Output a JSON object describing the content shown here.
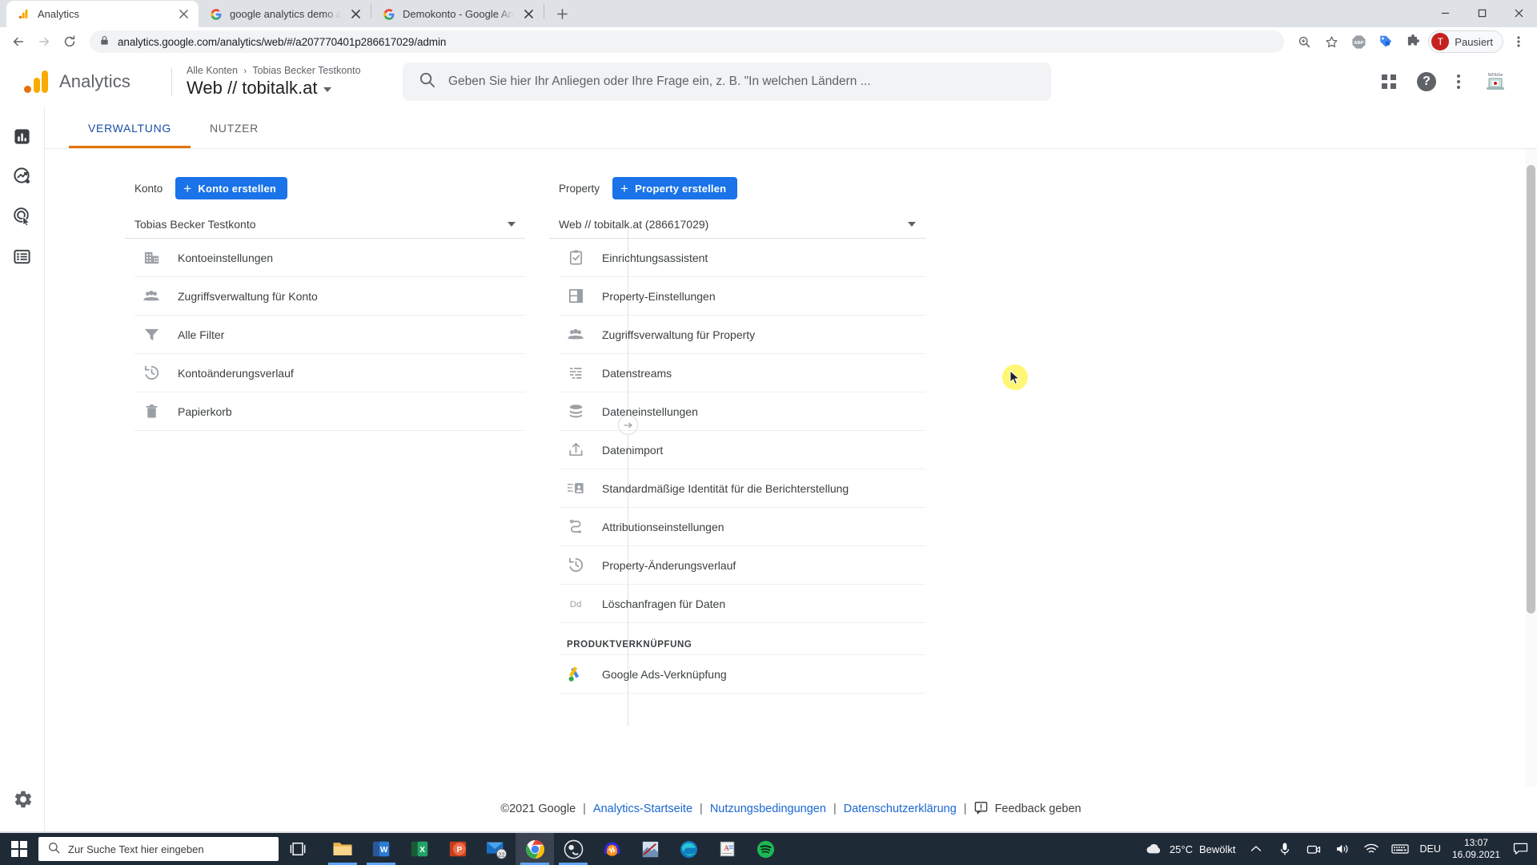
{
  "browser": {
    "tabs": [
      {
        "title": "Analytics",
        "favicon": "analytics-icon",
        "active": true
      },
      {
        "title": "google analytics demo account -",
        "favicon": "google-icon",
        "active": false
      },
      {
        "title": "Demokonto - Google Analytics-H",
        "favicon": "google-icon",
        "active": false
      }
    ],
    "new_tab_label": "+",
    "window_controls": {
      "minimize": "—",
      "maximize": "▢",
      "close": "✕"
    },
    "nav": {
      "back": "←",
      "forward": "→",
      "reload": "⟳"
    },
    "url": "analytics.google.com/analytics/web/#/a207770401p286617029/admin",
    "lock_icon": "lock-icon",
    "toolbar_icons": [
      "zoom-icon",
      "bookmark-star-icon",
      "adblock-icon",
      "tag-assistant-icon",
      "extensions-puzzle-icon"
    ],
    "profile": {
      "initial": "T",
      "label": "Pausiert"
    },
    "menu_icon": "chrome-menu-icon"
  },
  "analytics": {
    "brand": "Analytics",
    "breadcrumb": {
      "root": "Alle Konten",
      "separator": "›",
      "account": "Tobias Becker Testkonto"
    },
    "property_title": "Web // tobitalk.at",
    "search": {
      "placeholder": "Geben Sie hier Ihr Anliegen oder Ihre Frage ein, z. B. \"In welchen Ländern ..."
    },
    "header_icons": [
      "apps-grid-icon",
      "help-icon",
      "more-vert-icon",
      "avatar"
    ],
    "rail_items": [
      {
        "name": "reports-icon",
        "label": "Berichte"
      },
      {
        "name": "explore-icon",
        "label": "Explorativ"
      },
      {
        "name": "advertising-icon",
        "label": "Werbung"
      },
      {
        "name": "configure-icon",
        "label": "Konfigurieren"
      }
    ],
    "rail_bottom": {
      "name": "gear-icon",
      "label": "Verwaltung"
    },
    "tabs": [
      {
        "label": "VERWALTUNG",
        "selected": true
      },
      {
        "label": "NUTZER",
        "selected": false
      }
    ],
    "account_column": {
      "label": "Konto",
      "create_button": "Konto erstellen",
      "selected": "Tobias Becker Testkonto",
      "items": [
        {
          "icon": "building-icon",
          "label": "Kontoeinstellungen"
        },
        {
          "icon": "people-icon",
          "label": "Zugriffsverwaltung für Konto"
        },
        {
          "icon": "filter-icon",
          "label": "Alle Filter"
        },
        {
          "icon": "history-icon",
          "label": "Kontoänderungsverlauf"
        },
        {
          "icon": "trash-icon",
          "label": "Papierkorb"
        }
      ]
    },
    "property_column": {
      "label": "Property",
      "create_button": "Property erstellen",
      "selected": "Web // tobitalk.at (286617029)",
      "items": [
        {
          "icon": "checklist-icon",
          "label": "Einrichtungsassistent"
        },
        {
          "icon": "layout-icon",
          "label": "Property-Einstellungen"
        },
        {
          "icon": "people-icon",
          "label": "Zugriffsverwaltung für Property"
        },
        {
          "icon": "datastream-icon",
          "label": "Datenstreams"
        },
        {
          "icon": "database-icon",
          "label": "Dateneinstellungen"
        },
        {
          "icon": "upload-icon",
          "label": "Datenimport"
        },
        {
          "icon": "identity-card-icon",
          "label": "Standardmäßige Identität für die Berichterstellung"
        },
        {
          "icon": "attribution-icon",
          "label": "Attributionseinstellungen"
        },
        {
          "icon": "history-icon",
          "label": "Property-Änderungsverlauf"
        },
        {
          "icon": "dd-icon",
          "label": "Löschanfragen für Daten"
        }
      ],
      "section_label": "PRODUKTVERKNÜPFUNG",
      "section_items": [
        {
          "icon": "google-ads-icon",
          "label": "Google Ads-Verknüpfung"
        }
      ]
    },
    "collapse_icon": "collapse-arrow-icon",
    "footer": {
      "copyright": "©2021 Google",
      "links": [
        "Analytics-Startseite",
        "Nutzungsbedingungen",
        "Datenschutzerklärung"
      ],
      "feedback_icon": "feedback-icon",
      "feedback": "Feedback geben",
      "pipe": "|"
    }
  },
  "taskbar": {
    "start_icon": "windows-start-icon",
    "search_icon": "search-icon",
    "search_placeholder": "Zur Suche Text hier eingeben",
    "taskview_icon": "task-view-icon",
    "apps": [
      {
        "name": "file-explorer-icon",
        "running": true,
        "active": false
      },
      {
        "name": "word-icon",
        "running": true,
        "active": false
      },
      {
        "name": "excel-icon",
        "running": false,
        "active": false
      },
      {
        "name": "powerpoint-icon",
        "running": false,
        "active": false
      },
      {
        "name": "mail-icon",
        "running": false,
        "active": false,
        "badge": "22"
      },
      {
        "name": "chrome-icon",
        "running": true,
        "active": true
      },
      {
        "name": "obs-icon",
        "running": true,
        "active": false
      },
      {
        "name": "audacity-icon",
        "running": false,
        "active": false
      },
      {
        "name": "photoshop-icon",
        "running": false,
        "active": false
      },
      {
        "name": "edge-icon",
        "running": false,
        "active": false
      },
      {
        "name": "antidote-icon",
        "running": false,
        "active": false
      },
      {
        "name": "spotify-icon",
        "running": false,
        "active": false
      }
    ],
    "weather": {
      "icon": "cloud-icon",
      "temp": "25°C",
      "condition": "Bewölkt"
    },
    "tray": [
      "chevron-up-icon",
      "microphone-icon",
      "camera-icon",
      "volume-icon",
      "wifi-icon",
      "keyboard-icon"
    ],
    "language": "DEU",
    "time": "13:07",
    "date": "16.09.2021",
    "notification_icon": "notification-icon"
  },
  "colors": {
    "accent_blue": "#1a73e8",
    "tab_underline": "#e37400",
    "link_blue": "#1967d2",
    "ga_orange": "#f9ab00"
  }
}
